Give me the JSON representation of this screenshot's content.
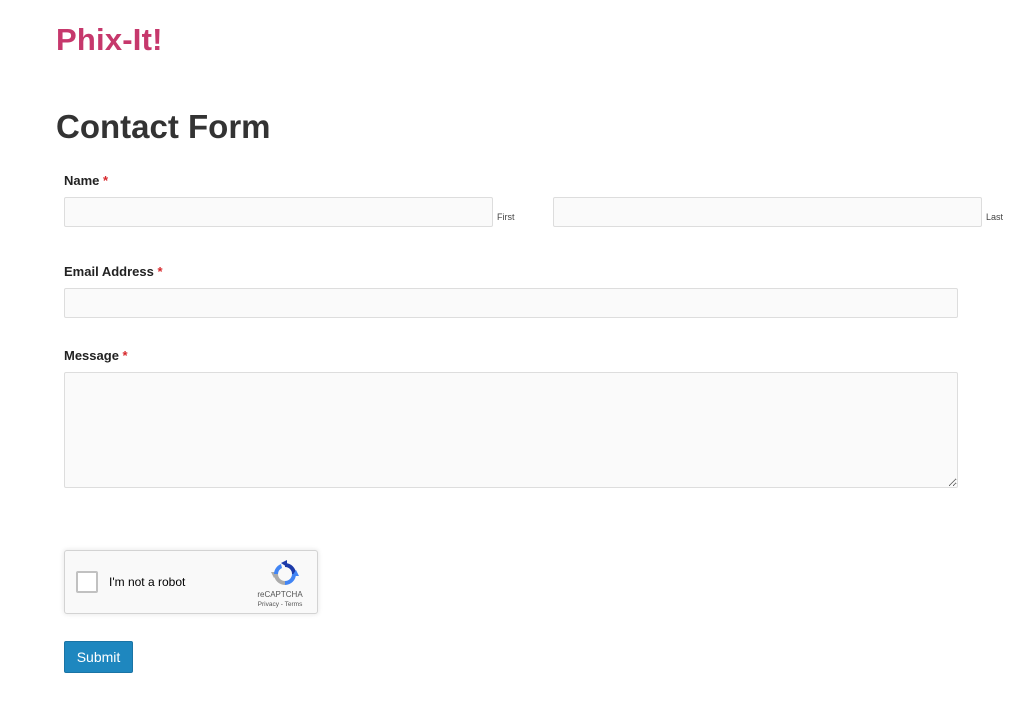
{
  "site": {
    "title": "Phix-It!",
    "brand_color": "#c6386c"
  },
  "page": {
    "title": "Contact Form"
  },
  "form": {
    "required_marker": "*",
    "name": {
      "label": "Name",
      "first": {
        "value": "",
        "sublabel": "First"
      },
      "last": {
        "value": "",
        "sublabel": "Last"
      }
    },
    "email": {
      "label": "Email Address",
      "value": ""
    },
    "message": {
      "label": "Message",
      "value": ""
    },
    "captcha": {
      "checked": false,
      "text": "I'm not a robot",
      "brand": "reCAPTCHA",
      "privacy": "Privacy",
      "separator": " - ",
      "terms": "Terms",
      "icon": "recaptcha-logo-icon"
    },
    "submit_label": "Submit",
    "submit_color": "#1e87bf"
  }
}
